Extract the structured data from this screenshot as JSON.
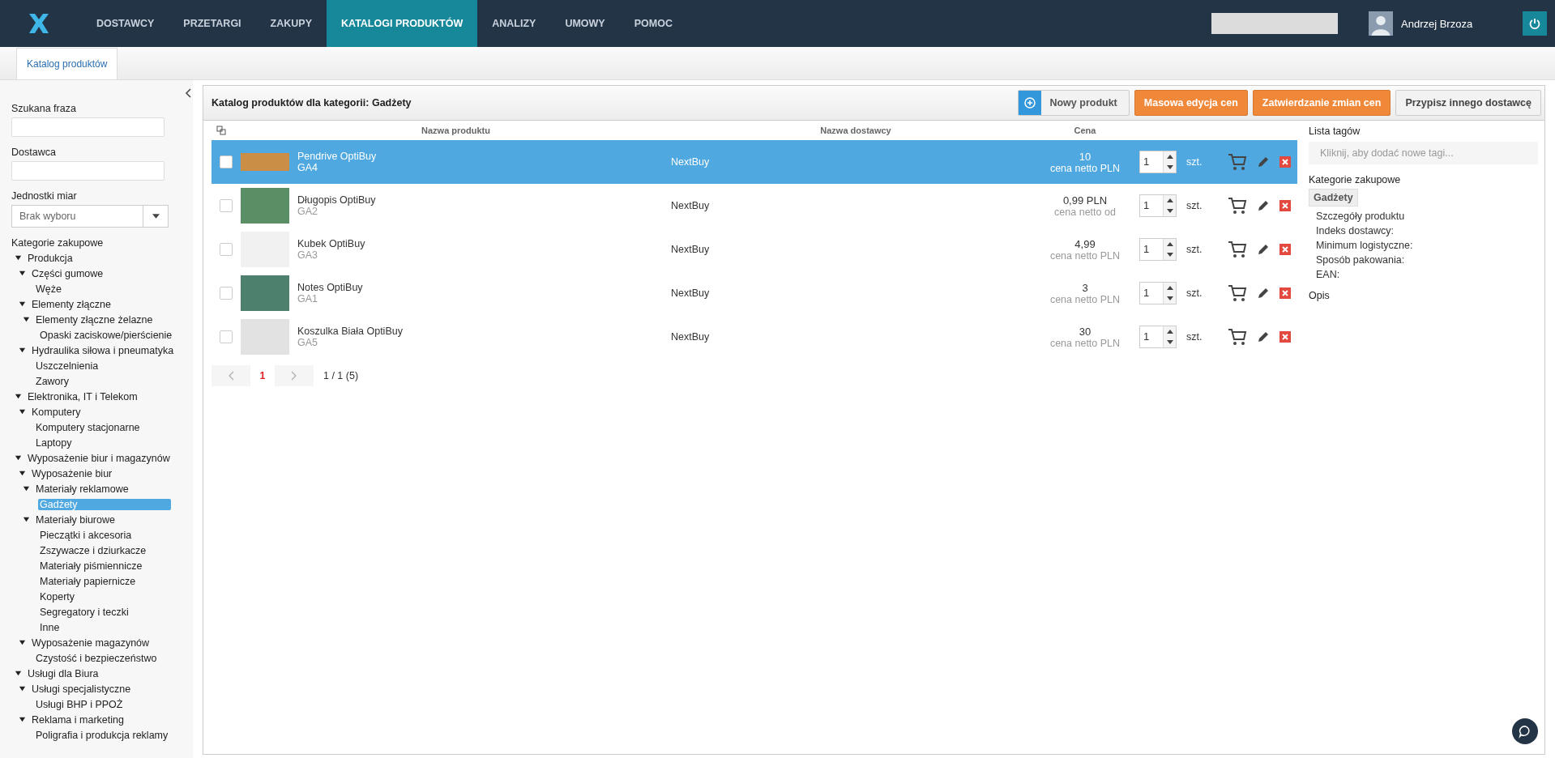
{
  "nav": {
    "items": [
      {
        "label": "DOSTAWCY",
        "selected": false
      },
      {
        "label": "PRZETARGI",
        "selected": false
      },
      {
        "label": "ZAKUPY",
        "selected": false
      },
      {
        "label": "KATALOGI PRODUKTÓW",
        "selected": true
      },
      {
        "label": "ANALIZY",
        "selected": false
      },
      {
        "label": "UMOWY",
        "selected": false
      },
      {
        "label": "POMOC",
        "selected": false
      }
    ],
    "user": "Andrzej Brzoza"
  },
  "subtabs": [
    {
      "label": "Katalog produktów",
      "selected": true
    }
  ],
  "filters": {
    "phrase_label": "Szukana fraza",
    "supplier_label": "Dostawca",
    "units_label": "Jednostki miar",
    "units_value": "Brak wyboru",
    "categories_label": "Kategorie zakupowe"
  },
  "tree": [
    {
      "label": "Produkcja",
      "expanded": true,
      "selected": false,
      "children": [
        {
          "label": "Części gumowe",
          "expanded": true,
          "selected": false,
          "children": [
            {
              "label": "Węże",
              "selected": false
            }
          ]
        },
        {
          "label": "Elementy złączne",
          "expanded": true,
          "selected": false,
          "children": [
            {
              "label": "Elementy złączne żelazne",
              "expanded": true,
              "selected": false,
              "children": [
                {
                  "label": "Opaski zaciskowe/pierścienie",
                  "selected": false
                }
              ]
            }
          ]
        },
        {
          "label": "Hydraulika siłowa i pneumatyka",
          "expanded": true,
          "selected": false,
          "children": [
            {
              "label": "Uszczelnienia",
              "selected": false
            },
            {
              "label": "Zawory",
              "selected": false
            }
          ]
        }
      ]
    },
    {
      "label": "Elektronika, IT i Telekom",
      "expanded": true,
      "selected": false,
      "children": [
        {
          "label": "Komputery",
          "expanded": true,
          "selected": false,
          "children": [
            {
              "label": "Komputery stacjonarne",
              "selected": false
            },
            {
              "label": "Laptopy",
              "selected": false
            }
          ]
        }
      ]
    },
    {
      "label": "Wyposażenie biur i magazynów",
      "expanded": true,
      "selected": false,
      "children": [
        {
          "label": "Wyposażenie biur",
          "expanded": true,
          "selected": false,
          "children": [
            {
              "label": "Materiały reklamowe",
              "expanded": true,
              "selected": false,
              "children": [
                {
                  "label": "Gadżety",
                  "selected": true
                }
              ]
            },
            {
              "label": "Materiały biurowe",
              "expanded": true,
              "selected": false,
              "children": [
                {
                  "label": "Pieczątki i akcesoria",
                  "selected": false
                },
                {
                  "label": "Zszywacze i dziurkacze",
                  "selected": false
                },
                {
                  "label": "Materiały piśmiennicze",
                  "selected": false
                },
                {
                  "label": "Materiały papiernicze",
                  "selected": false
                },
                {
                  "label": "Koperty",
                  "selected": false
                },
                {
                  "label": "Segregatory i teczki",
                  "selected": false
                },
                {
                  "label": "Inne",
                  "selected": false
                }
              ]
            }
          ]
        },
        {
          "label": "Wyposażenie magazynów",
          "expanded": true,
          "selected": false,
          "children": [
            {
              "label": "Czystość i bezpieczeństwo",
              "selected": false
            }
          ]
        }
      ]
    },
    {
      "label": "Usługi dla Biura",
      "expanded": true,
      "selected": false,
      "children": [
        {
          "label": "Usługi specjalistyczne",
          "expanded": true,
          "selected": false,
          "children": [
            {
              "label": "Usługi BHP i PPOŻ",
              "selected": false
            }
          ]
        },
        {
          "label": "Reklama i marketing",
          "expanded": true,
          "selected": false,
          "children": [
            {
              "label": "Poligrafia i produkcja reklamy",
              "selected": false
            }
          ]
        }
      ]
    }
  ],
  "panel": {
    "title": "Katalog produktów dla kategorii: Gadżety",
    "buttons": [
      {
        "label": "Nowy produkt",
        "kind": "add"
      },
      {
        "label": "Masowa edycja cen",
        "kind": "accent"
      },
      {
        "label": "Zatwierdzanie zmian cen",
        "kind": "accent"
      },
      {
        "label": "Przypisz innego dostawcę",
        "kind": "plain"
      }
    ]
  },
  "table": {
    "columns": [
      "Nazwa produktu",
      "Nazwa dostawcy",
      "Cena"
    ],
    "rows": [
      {
        "name": "Pendrive OptiBuy",
        "code": "GA4",
        "supplier": "NextBuy",
        "price": "10",
        "price_note": "cena netto PLN",
        "qty": "1",
        "unit": "szt.",
        "selected": true,
        "checked": false
      },
      {
        "name": "Długopis OptiBuy",
        "code": "GA2",
        "supplier": "NextBuy",
        "price": "0,99 PLN",
        "price_note": "cena netto od",
        "qty": "1",
        "unit": "szt.",
        "selected": false,
        "checked": false
      },
      {
        "name": "Kubek OptiBuy",
        "code": "GA3",
        "supplier": "NextBuy",
        "price": "4,99",
        "price_note": "cena netto PLN",
        "qty": "1",
        "unit": "szt.",
        "selected": false,
        "checked": false
      },
      {
        "name": "Notes OptiBuy",
        "code": "GA1",
        "supplier": "NextBuy",
        "price": "3",
        "price_note": "cena netto PLN",
        "qty": "1",
        "unit": "szt.",
        "selected": false,
        "checked": false
      },
      {
        "name": "Koszulka Biała OptiBuy",
        "code": "GA5",
        "supplier": "NextBuy",
        "price": "30",
        "price_note": "cena netto PLN",
        "qty": "1",
        "unit": "szt.",
        "selected": false,
        "checked": false
      }
    ],
    "pagination": {
      "pages": [
        {
          "label": "1",
          "selected": true
        }
      ],
      "summary": "1 / 1 (5)"
    }
  },
  "details": {
    "tags_label": "Lista tagów",
    "tags_placeholder": "Kliknij, aby dodać nowe tagi...",
    "categories_label": "Kategorie zakupowe",
    "category_chip": "Gadżety",
    "product_details": [
      "Szczegóły produktu",
      "Indeks dostawcy:",
      "Minimum logistyczne:",
      "Sposób pakowania:",
      "EAN:"
    ],
    "description_label": "Opis"
  }
}
